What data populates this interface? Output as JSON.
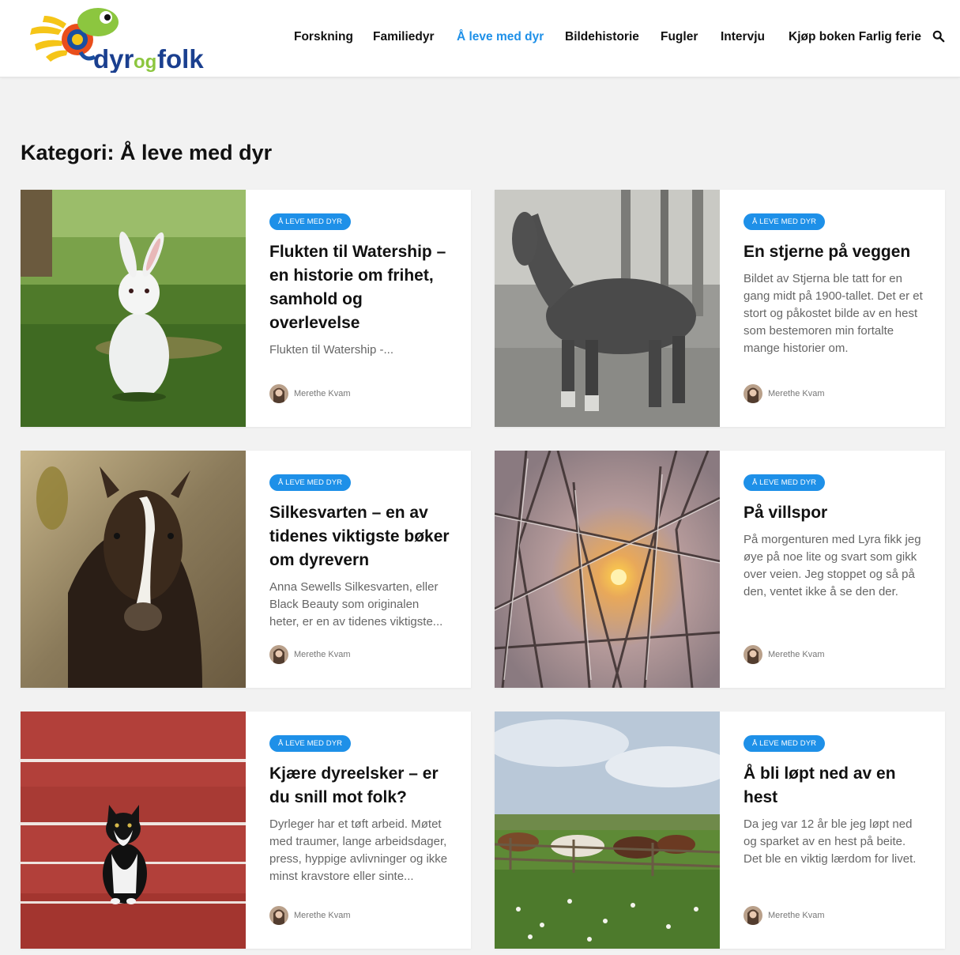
{
  "header": {
    "logo_text": "dyrogfolk",
    "nav": [
      {
        "label": "Forskning"
      },
      {
        "label": "Familiedyr"
      },
      {
        "label": "Å leve med dyr"
      },
      {
        "label": "Bildehistorie"
      },
      {
        "label": "Fugler"
      },
      {
        "label": "Intervju"
      },
      {
        "label": "Kjøp boken Farlig ferie"
      }
    ],
    "search_icon": "search-icon"
  },
  "page_title": "Kategori: Å leve med dyr",
  "posts": [
    {
      "category": "Å leve med dyr",
      "title": "Flukten til Watership – en historie om frihet, samhold og overlevelse",
      "excerpt": "Flukten til Watership -...",
      "author": "Merethe Kvam",
      "image": "white rabbit on grass"
    },
    {
      "category": "Å leve med dyr",
      "title": "En stjerne på veggen",
      "excerpt": "Bildet av Stjerna ble tatt for en gang midt på 1900-tallet. Det er et stort og påkostet bilde av en hest som bestemoren min fortalte mange historier om.",
      "author": "Merethe Kvam",
      "image": "old photo of a horse"
    },
    {
      "category": "Å leve med dyr",
      "title": "Silkesvarten – en av tidenes viktigste bøker om dyrevern",
      "excerpt": "Anna Sewells Silkesvarten, eller Black Beauty som originalen heter, er en av tidenes viktigste...",
      "author": "Merethe Kvam",
      "image": "foal with white blaze"
    },
    {
      "category": "Å leve med dyr",
      "title": "På villspor",
      "excerpt": "På morgenturen med Lyra fikk jeg øye på noe lite og svart som gikk over veien. Jeg stoppet og så på den, ventet ikke å se den der.",
      "author": "Merethe Kvam",
      "image": "frosty branches at sunrise"
    },
    {
      "category": "Å leve med dyr",
      "title": "Kjære dyreelsker – er du snill mot folk?",
      "excerpt": "Dyrleger har et tøft arbeid. Møtet med traumer, lange arbeidsdager, press, hyppige avlivninger og ikke minst kravstore eller sinte...",
      "author": "Merethe Kvam",
      "image": "black and white kitten on red steps"
    },
    {
      "category": "Å leve med dyr",
      "title": "Å bli løpt ned av en hest",
      "excerpt": "Da jeg var 12 år ble jeg løpt ned og sparket av en hest på beite. Det ble en viktig lærdom for livet.",
      "author": "Merethe Kvam",
      "image": "horses in a meadow"
    }
  ]
}
